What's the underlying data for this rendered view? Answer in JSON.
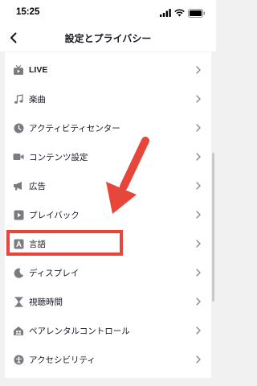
{
  "status": {
    "time": "15:25"
  },
  "header": {
    "title": "設定とプライバシー"
  },
  "menu": {
    "items": [
      {
        "label": "LIVE",
        "icon": "tv-icon"
      },
      {
        "label": "楽曲",
        "icon": "music-note-icon"
      },
      {
        "label": "アクティビティセンター",
        "icon": "clock-icon"
      },
      {
        "label": "コンテンツ設定",
        "icon": "video-camera-icon"
      },
      {
        "label": "広告",
        "icon": "megaphone-icon"
      },
      {
        "label": "プレイバック",
        "icon": "play-square-icon"
      },
      {
        "label": "言語",
        "icon": "language-icon"
      },
      {
        "label": "ディスプレイ",
        "icon": "moon-icon"
      },
      {
        "label": "視聴時間",
        "icon": "hourglass-icon"
      },
      {
        "label": "ペアレンタルコントロール",
        "icon": "family-house-icon"
      },
      {
        "label": "アクセシビリティ",
        "icon": "accessibility-icon"
      }
    ]
  },
  "annotation": {
    "highlighted_item": "言語",
    "color": "#e6473a"
  }
}
